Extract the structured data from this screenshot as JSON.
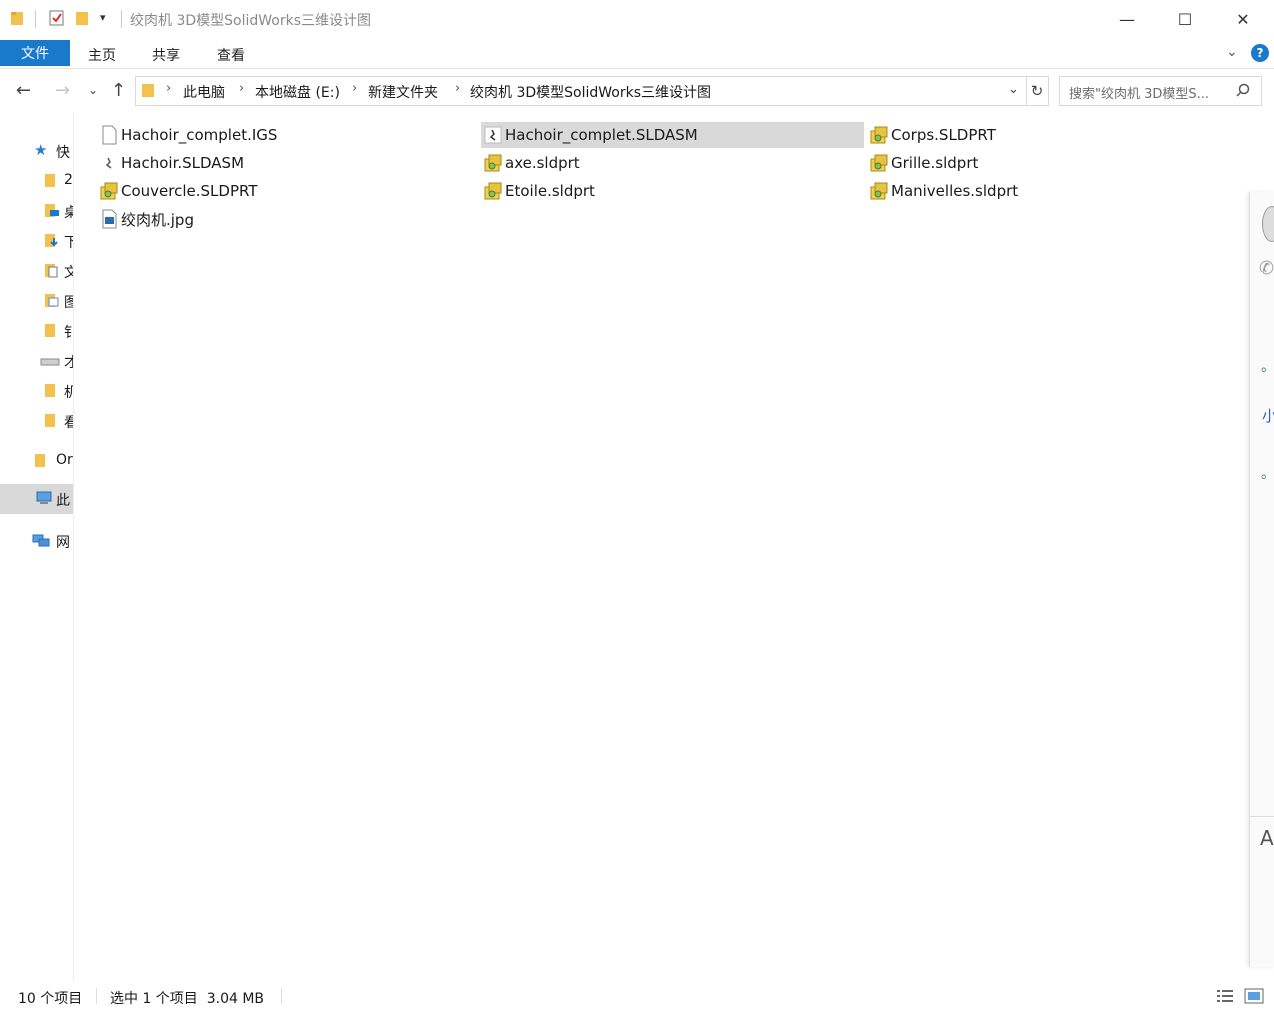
{
  "window": {
    "title": "绞肉机 3D模型SolidWorks三维设计图",
    "controls": {
      "minimize": "—",
      "maximize": "☐",
      "close": "✕"
    }
  },
  "ribbon": {
    "file_tab": "文件",
    "tabs": [
      "主页",
      "共享",
      "查看"
    ],
    "help": "?"
  },
  "address": {
    "breadcrumbs": [
      "此电脑",
      "本地磁盘 (E:)",
      "新建文件夹",
      "绞肉机 3D模型SolidWorks三维设计图"
    ],
    "search_placeholder": "搜索\"绞肉机 3D模型S..."
  },
  "nav": {
    "items": [
      {
        "label": "快",
        "icon": "star-icon"
      },
      {
        "label": "2",
        "icon": "folder-icon"
      },
      {
        "label": "桌",
        "icon": "desktop-folder-icon"
      },
      {
        "label": "下",
        "icon": "downloads-icon"
      },
      {
        "label": "文",
        "icon": "documents-icon"
      },
      {
        "label": "图",
        "icon": "pictures-icon"
      },
      {
        "label": "钅",
        "icon": "folder-icon"
      },
      {
        "label": "才",
        "icon": "drive-icon"
      },
      {
        "label": "机",
        "icon": "folder-icon"
      },
      {
        "label": "看",
        "icon": "folder-icon"
      },
      {
        "label": "Or",
        "icon": "onedrive-folder-icon"
      },
      {
        "label": "此",
        "icon": "this-pc-icon"
      },
      {
        "label": "网",
        "icon": "network-icon"
      }
    ]
  },
  "files": [
    {
      "name": "Hachoir_complet.IGS",
      "icon": "generic-file-icon"
    },
    {
      "name": "Hachoir.SLDASM",
      "icon": "sldasm-file-icon"
    },
    {
      "name": "Couvercle.SLDPRT",
      "icon": "sldprt-file-icon"
    },
    {
      "name": "绞肉机.jpg",
      "icon": "image-file-icon"
    },
    {
      "name": "Hachoir_complet.SLDASM",
      "icon": "sldasm-file-icon"
    },
    {
      "name": "axe.sldprt",
      "icon": "sldprt-file-icon"
    },
    {
      "name": "Etoile.sldprt",
      "icon": "sldprt-file-icon"
    },
    {
      "name": "Corps.SLDPRT",
      "icon": "sldprt-file-icon"
    },
    {
      "name": "Grille.sldprt",
      "icon": "sldprt-file-icon"
    },
    {
      "name": "Manivelles.sldprt",
      "icon": "sldprt-file-icon"
    }
  ],
  "status": {
    "item_count": "10 个项目",
    "selection": "选中 1 个项目  3.04 MB"
  },
  "side_panel": {
    "glyphs": [
      "。",
      "小",
      "。",
      "A"
    ]
  },
  "colors": {
    "accent": "#1979ca",
    "selection": "#d9d9d9",
    "folder": "#f2c14e"
  }
}
